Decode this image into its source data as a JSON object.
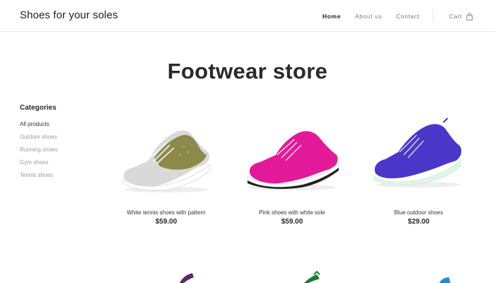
{
  "header": {
    "brand": "Shoes for your soles",
    "nav": [
      {
        "label": "Home",
        "active": true
      },
      {
        "label": "About us",
        "active": false
      },
      {
        "label": "Contact",
        "active": false
      }
    ],
    "cart_label": "Cart",
    "cart_icon": "shopping-bag-icon"
  },
  "main": {
    "title": "Footwear store"
  },
  "sidebar": {
    "title": "Categories",
    "items": [
      {
        "label": "All products",
        "active": true
      },
      {
        "label": "Outdoor shoes",
        "active": false
      },
      {
        "label": "Running shoes",
        "active": false
      },
      {
        "label": "Gym shoes",
        "active": false
      },
      {
        "label": "Tennis shoes",
        "active": false
      }
    ]
  },
  "products": [
    {
      "name": "White tennis shoes with pattern",
      "price": "$59.00",
      "color": "#8c8a4a"
    },
    {
      "name": "Pink shoes with white sole",
      "price": "$59.00",
      "color": "#e21a9a"
    },
    {
      "name": "Blue outdoor shoes",
      "price": "$29.00",
      "color": "#4a36c8"
    }
  ],
  "colors": {
    "text_dark": "#2a2a2a",
    "text_muted": "#9a9a9a",
    "border": "#ebebeb"
  }
}
